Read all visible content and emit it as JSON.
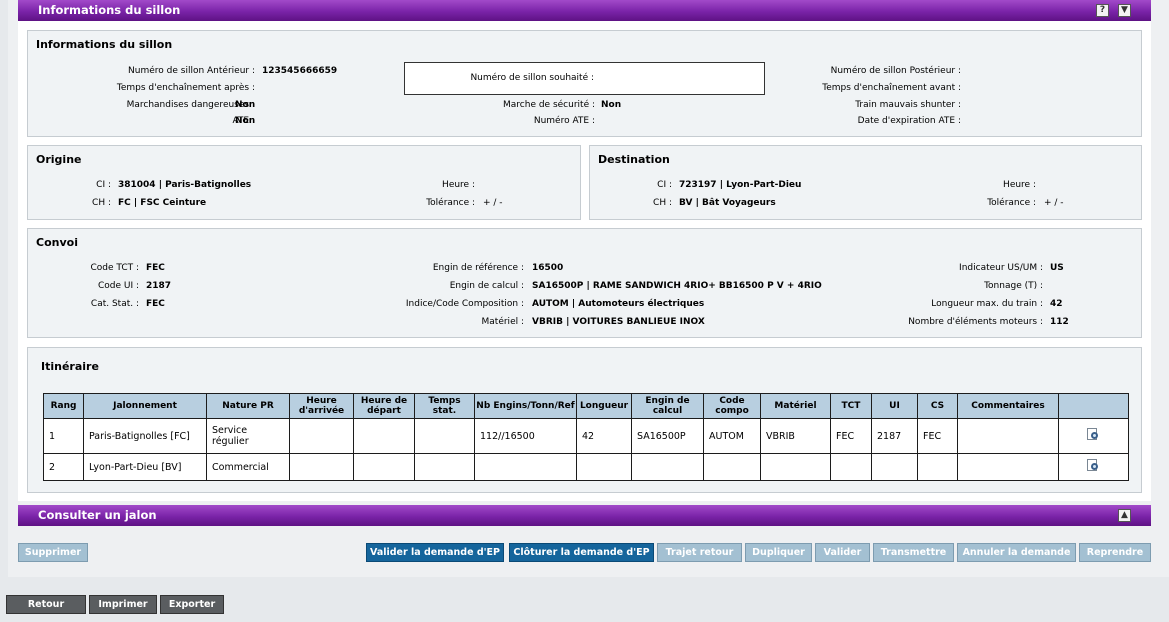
{
  "header": {
    "title": "Informations du sillon",
    "help_icon": "?",
    "collapse_icon": "▼"
  },
  "sillon": {
    "title": "Informations du sillon",
    "fields_left": [
      {
        "label": "Numéro de sillon Antérieur :",
        "value": "123545666659"
      },
      {
        "label": "Temps d'enchaînement après :",
        "value": ""
      },
      {
        "label": "Marchandises dangereuses :",
        "value": "Non"
      },
      {
        "label": "ATE :",
        "value": "Non"
      }
    ],
    "souhaite_label": "Numéro de sillon souhaité :",
    "fields_mid": [
      {
        "label": "Marche de sécurité :",
        "value": "Non"
      },
      {
        "label": "Numéro ATE :",
        "value": ""
      }
    ],
    "fields_right": [
      {
        "label": "Numéro de sillon Postérieur :",
        "value": ""
      },
      {
        "label": "Temps d'enchaînement avant :",
        "value": ""
      },
      {
        "label": "Train mauvais shunter :",
        "value": ""
      },
      {
        "label": "Date d'expiration ATE :",
        "value": ""
      }
    ]
  },
  "origine": {
    "title": "Origine",
    "ci_label": "CI :",
    "ci_value": "381004 | Paris-Batignolles",
    "ch_label": "CH :",
    "ch_value": "FC | FSC Ceinture",
    "heure_label": "Heure :",
    "heure_value": "",
    "tol_label": "Tolérance :",
    "tol_value": "+ / -"
  },
  "destination": {
    "title": "Destination",
    "ci_label": "CI :",
    "ci_value": "723197 | Lyon-Part-Dieu",
    "ch_label": "CH :",
    "ch_value": "BV | Bât Voyageurs",
    "heure_label": "Heure :",
    "heure_value": "",
    "tol_label": "Tolérance :",
    "tol_value": "+ / -"
  },
  "convoi": {
    "title": "Convoi",
    "left": [
      {
        "label": "Code TCT :",
        "value": "FEC"
      },
      {
        "label": "Code UI :",
        "value": "2187"
      },
      {
        "label": "Cat. Stat. :",
        "value": "FEC"
      }
    ],
    "mid": [
      {
        "label": "Engin de référence :",
        "value": "16500"
      },
      {
        "label": "Engin de calcul :",
        "value": "SA16500P | RAME SANDWICH 4RIO+ BB16500 P V + 4RIO"
      },
      {
        "label": "Indice/Code Composition :",
        "value": "AUTOM | Automoteurs électriques"
      },
      {
        "label": "Matériel :",
        "value": "VBRIB | VOITURES BANLIEUE INOX"
      }
    ],
    "right": [
      {
        "label": "Indicateur US/UM :",
        "value": "US"
      },
      {
        "label": "Tonnage (T) :",
        "value": ""
      },
      {
        "label": "Longueur max. du train :",
        "value": "42"
      },
      {
        "label": "Nombre d'éléments moteurs :",
        "value": "112"
      }
    ]
  },
  "itineraire": {
    "title": "Itinéraire",
    "columns": [
      "Rang",
      "Jalonnement",
      "Nature PR",
      "Heure d'arrivée",
      "Heure de départ",
      "Temps stat.",
      "Nb Engins/Tonn/Ref",
      "Longueur",
      "Engin de calcul",
      "Code compo",
      "Matériel",
      "TCT",
      "UI",
      "CS",
      "Commentaires",
      ""
    ],
    "rows": [
      [
        "1",
        "Paris-Batignolles [FC]",
        "Service régulier",
        "",
        "",
        "",
        "112//16500",
        "42",
        "SA16500P",
        "AUTOM",
        "VBRIB",
        "FEC",
        "2187",
        "FEC",
        ""
      ],
      [
        "2",
        "Lyon-Part-Dieu [BV]",
        "Commercial",
        "",
        "",
        "",
        "",
        "",
        "",
        "",
        "",
        "",
        "",
        "",
        ""
      ]
    ]
  },
  "jalon": {
    "title": "Consulter un jalon",
    "expand_icon": "▲"
  },
  "actions": {
    "supprimer": "Supprimer",
    "valider_demande": "Valider la demande d'EP",
    "cloturer_demande": "Clôturer la demande d'EP",
    "trajet_retour": "Trajet retour",
    "dupliquer": "Dupliquer",
    "valider": "Valider",
    "transmettre": "Transmettre",
    "annuler": "Annuler la demande",
    "reprendre": "Reprendre"
  },
  "footer": {
    "retour": "Retour",
    "imprimer": "Imprimer",
    "exporter": "Exporter"
  }
}
